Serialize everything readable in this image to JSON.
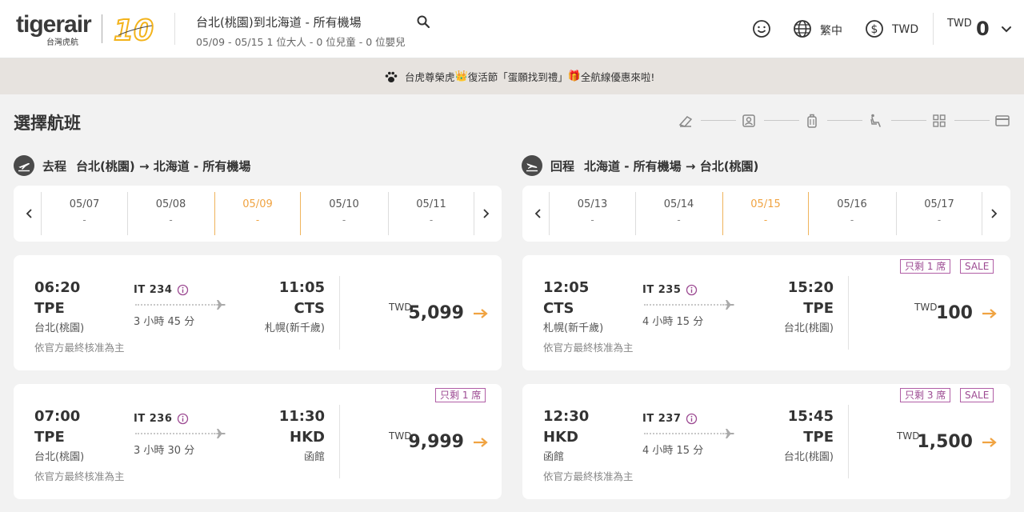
{
  "header": {
    "logo_text": "tigerair",
    "logo_sub": "台灣虎航",
    "logo_ten": "10",
    "route_title": "台北(桃園)到北海道 - 所有機場",
    "route_sub": "05/09 - 05/15  1 位大人 - 0 位兒童 - 0 位嬰兒",
    "language": "繁中",
    "currency": "TWD",
    "total_currency": "TWD",
    "total_amount": "0"
  },
  "banner": {
    "text_a": "台虎尊榮虎",
    "text_b": "復活節「蛋願找到禮」",
    "text_c": "全航線優惠來啦!"
  },
  "page_title": "選擇航班",
  "outbound": {
    "kind": "去程",
    "route": "台北(桃園) → 北海道 - 所有機場",
    "dates": [
      {
        "date": "05/07",
        "price": "-"
      },
      {
        "date": "05/08",
        "price": "-"
      },
      {
        "date": "05/09",
        "price": "-"
      },
      {
        "date": "05/10",
        "price": "-"
      },
      {
        "date": "05/11",
        "price": "-"
      }
    ],
    "flights": [
      {
        "dep_time": "06:20",
        "dep_code": "TPE",
        "dep_city": "台北(桃園)",
        "flight_no": "IT 234",
        "duration": "3 小時 45 分",
        "arr_time": "11:05",
        "arr_code": "CTS",
        "arr_city": "札幌(新千歲)",
        "note": "依官方最終核准為主",
        "price_currency": "TWD",
        "price": "5,099",
        "tags": []
      },
      {
        "dep_time": "07:00",
        "dep_code": "TPE",
        "dep_city": "台北(桃園)",
        "flight_no": "IT 236",
        "duration": "3 小時 30 分",
        "arr_time": "11:30",
        "arr_code": "HKD",
        "arr_city": "函館",
        "note": "依官方最終核准為主",
        "price_currency": "TWD",
        "price": "9,999",
        "tags": [
          "只剩 1 席"
        ]
      }
    ]
  },
  "inbound": {
    "kind": "回程",
    "route": "北海道 - 所有機場 → 台北(桃園)",
    "dates": [
      {
        "date": "05/13",
        "price": "-"
      },
      {
        "date": "05/14",
        "price": "-"
      },
      {
        "date": "05/15",
        "price": "-"
      },
      {
        "date": "05/16",
        "price": "-"
      },
      {
        "date": "05/17",
        "price": "-"
      }
    ],
    "flights": [
      {
        "dep_time": "12:05",
        "dep_code": "CTS",
        "dep_city": "札幌(新千歲)",
        "flight_no": "IT 235",
        "duration": "4 小時 15 分",
        "arr_time": "15:20",
        "arr_code": "TPE",
        "arr_city": "台北(桃園)",
        "note": "依官方最終核准為主",
        "price_currency": "TWD",
        "price": "100",
        "tags": [
          "只剩 1 席",
          "SALE"
        ]
      },
      {
        "dep_time": "12:30",
        "dep_code": "HKD",
        "dep_city": "函館",
        "flight_no": "IT 237",
        "duration": "4 小時 15 分",
        "arr_time": "15:45",
        "arr_code": "TPE",
        "arr_city": "台北(桃園)",
        "note": "依官方最終核准為主",
        "price_currency": "TWD",
        "price": "1,500",
        "tags": [
          "只剩 3 席",
          "SALE"
        ]
      }
    ]
  },
  "colors": {
    "accent": "#f0a341",
    "tag": "#9c4a92",
    "brand_yellow": "#f3b31b"
  }
}
